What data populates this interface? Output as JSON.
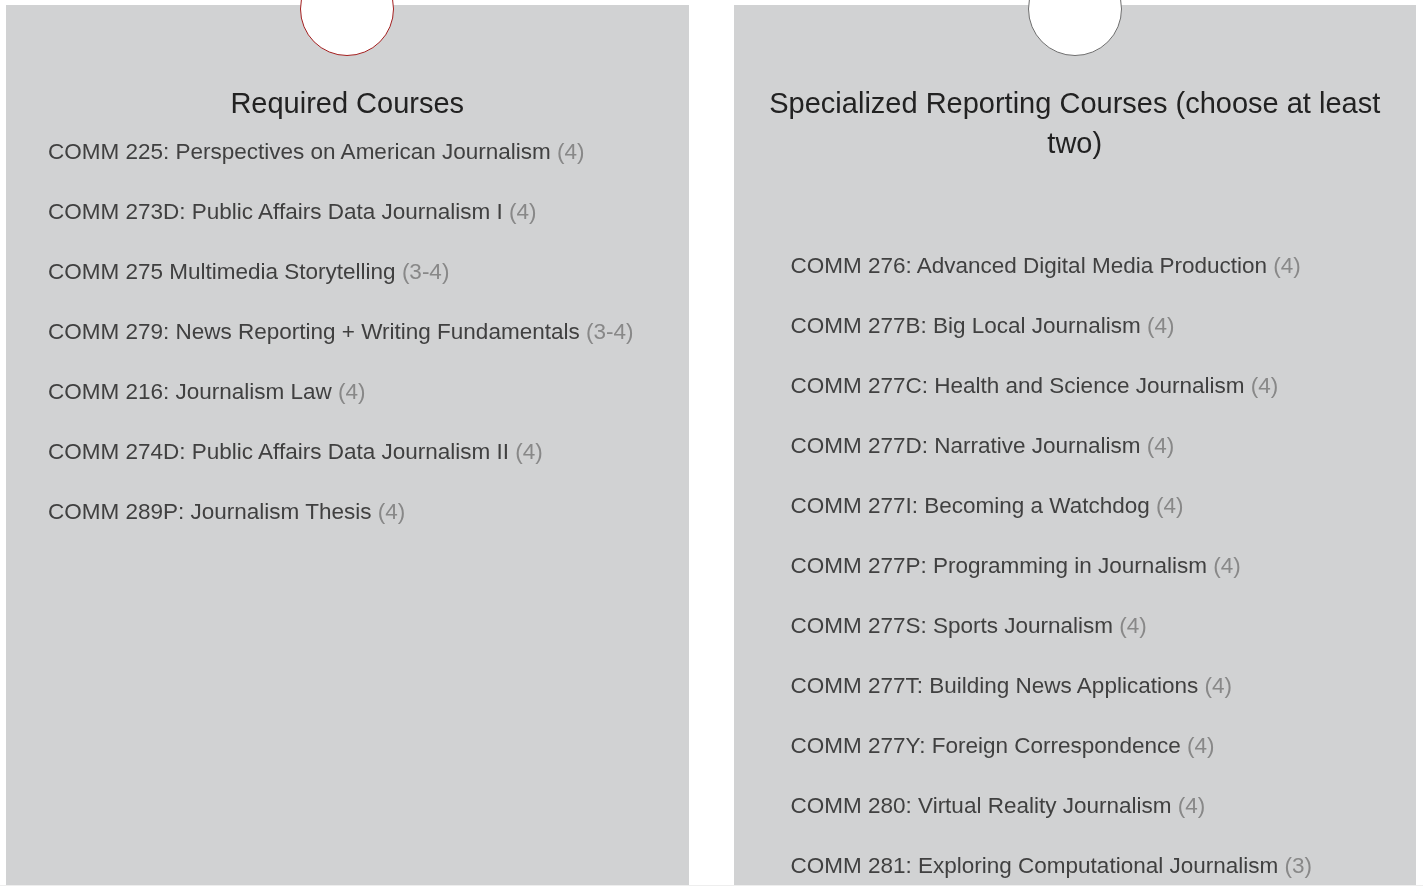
{
  "panels": [
    {
      "title": "Required Courses",
      "color": "#a31f1f",
      "courses": [
        {
          "name": "COMM 225: Perspectives on American Journalism",
          "credits": "(4)"
        },
        {
          "name": "COMM 273D: Public Affairs Data Journalism I",
          "credits": "(4)"
        },
        {
          "name": "COMM 275 Multimedia Storytelling",
          "credits": "(3-4)"
        },
        {
          "name": "COMM 279: News Reporting + Writing Fundamentals",
          "credits": "(3-4)"
        },
        {
          "name": "COMM 216: Journalism Law",
          "credits": "(4)"
        },
        {
          "name": "COMM 274D: Public Affairs Data Journalism II",
          "credits": "(4)"
        },
        {
          "name": "COMM 289P: Journalism Thesis",
          "credits": "(4)"
        }
      ]
    },
    {
      "title": "Specialized Reporting Courses (choose at least two)",
      "color": "#6e6e6e",
      "courses": [
        {
          "name": "COMM 276: Advanced Digital Media Production",
          "credits": "(4)"
        },
        {
          "name": "COMM 277B: Big Local Journalism",
          "credits": "(4)"
        },
        {
          "name": "COMM 277C: Health and Science Journalism",
          "credits": "(4)"
        },
        {
          "name": "COMM 277D: Narrative Journalism",
          "credits": "(4)"
        },
        {
          "name": "COMM 277I: Becoming a Watchdog",
          "credits": "(4)"
        },
        {
          "name": "COMM 277P: Programming in Journalism",
          "credits": "(4)"
        },
        {
          "name": "COMM 277S: Sports Journalism",
          "credits": "(4)"
        },
        {
          "name": "COMM 277T: Building News Applications",
          "credits": "(4)"
        },
        {
          "name": "COMM 277Y: Foreign Correspondence",
          "credits": "(4)"
        },
        {
          "name": "COMM 280: Virtual Reality Journalism",
          "credits": "(4)"
        },
        {
          "name": "COMM 281: Exploring Computational Journalism",
          "credits": "(3)"
        }
      ]
    }
  ]
}
